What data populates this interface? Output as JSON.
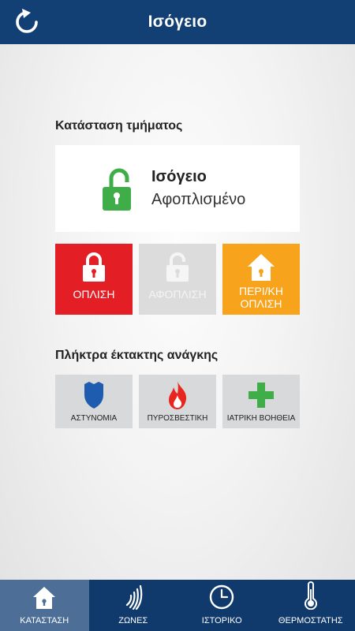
{
  "header": {
    "title": "Ισόγειο",
    "refresh_icon": "refresh-icon"
  },
  "status": {
    "section_title": "Κατάσταση τμήματος",
    "zone_name": "Ισόγειο",
    "state": "Αφοπλισμένο",
    "icon": "unlocked-padlock-icon",
    "icon_color": "#3fae49"
  },
  "actions": {
    "arm_label": "ΟΠΛΙΣΗ",
    "disarm_label": "ΑΦΟΠΛΙΣΗ",
    "stay_label_line1": "ΠΕΡΙ/ΚΗ",
    "stay_label_line2": "ΟΠΛΙΣΗ",
    "arm_color": "#e31e25",
    "disarm_color": "#dcdcdc",
    "stay_color": "#f7a31c"
  },
  "emergency": {
    "section_title": "Πλήκτρα έκτακτης ανάγκης",
    "police_label": "ΑΣΤΥΝΟΜΙΑ",
    "fire_label": "ΠΥΡΟΣΒΕΣΤΙΚΗ",
    "medical_label": "ΙΑΤΡΙΚΗ ΒΟΗΘΕΙΑ"
  },
  "tabs": [
    {
      "label": "ΚΑΤΑΣΤΑΣΗ",
      "icon": "home-icon",
      "active": true
    },
    {
      "label": "ΖΩΝΕΣ",
      "icon": "signal-waves-icon",
      "active": false
    },
    {
      "label": "ΙΣΤΟΡΙΚΟ",
      "icon": "clock-icon",
      "active": false
    },
    {
      "label": "ΘΕΡΜΟΣΤΑΤΗΣ",
      "icon": "thermometer-icon",
      "active": false
    }
  ]
}
